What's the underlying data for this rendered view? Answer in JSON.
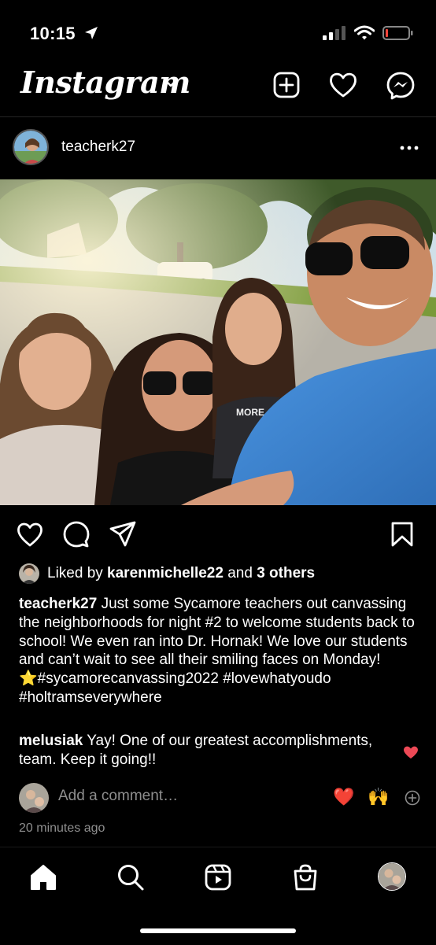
{
  "status_bar": {
    "time": "10:15"
  },
  "header": {
    "logo_text": "Instagram"
  },
  "post": {
    "username": "teacherk27",
    "likes": {
      "prefix": "Liked by ",
      "user": "karenmichelle22",
      "middle": " and ",
      "others": "3 others"
    },
    "caption": {
      "username": "teacherk27",
      "text": " Just some Sycamore teachers out canvassing the neighborhoods for night #2 to welcome students back to school! We even ran into Dr. Hornak! We love our students and can’t wait to see all their smiling faces on Monday! ",
      "emoji": "⭐️",
      "hashtags": "#sycamorecanvassing2022 #lovewhatyoudo #holtramseverywhere"
    },
    "comment": {
      "username": "melusiak",
      "text": " Yay! One of our greatest accomplishments, team. Keep it going!!"
    },
    "add_comment": {
      "placeholder": "Add a comment…",
      "quick_emojis": [
        "❤️",
        "🙌"
      ]
    },
    "timestamp": "20 minutes ago",
    "shirt_text": "MORE"
  },
  "colors": {
    "heart_red": "#ed4956",
    "muted_text": "#8e8e8e",
    "divider": "#262626"
  }
}
